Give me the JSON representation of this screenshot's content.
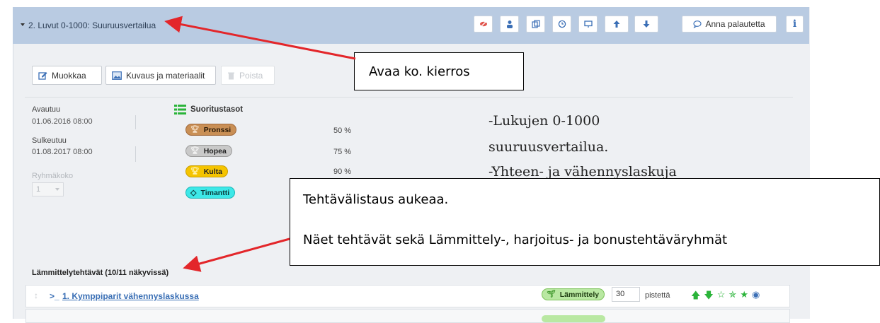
{
  "header": {
    "title": "2. Luvut 0-1000: Suuruusvertailua",
    "feedback_label": "Anna palautetta",
    "info_label": "i"
  },
  "toolbar": {
    "edit_label": "Muokkaa",
    "description_label": "Kuvaus ja materiaalit",
    "delete_label": "Poista"
  },
  "schedule": {
    "opens_label": "Avautuu",
    "opens_value": "01.06.2016 08:00",
    "closes_label": "Sulkeutuu",
    "closes_value": "01.08.2017 08:00",
    "group_label": "Ryhmäkoko",
    "group_value": "1"
  },
  "levels": {
    "heading": "Suoritustasot",
    "items": [
      {
        "name": "Pronssi",
        "percent": "50 %"
      },
      {
        "name": "Hopea",
        "percent": "75 %"
      },
      {
        "name": "Kulta",
        "percent": "90 %"
      },
      {
        "name": "Timantti",
        "percent": ""
      }
    ]
  },
  "description": {
    "line1": "-Lukujen 0-1000",
    "line2": "suuruusvertailua.",
    "line3": "-Yhteen- ja vähennyslaskuja"
  },
  "callouts": {
    "open_round": "Avaa ko. kierros",
    "list_line1": "Tehtävälistaus aukeaa.",
    "list_line2": "Näet tehtävät sekä Lämmittely-, harjoitus- ja bonustehtäväryhmät"
  },
  "tasks": {
    "group_heading": "Lämmittelytehtävät (10/11 näkyvissä)",
    "rows": [
      {
        "prefix": ">_",
        "title": "1. Kymppiparit vähennyslaskussa",
        "type": "Lämmittely",
        "points": "30",
        "points_label": "pistettä"
      }
    ]
  },
  "colors": {
    "header_bg": "#b9cbe2",
    "bronze": "#c98f55",
    "silver": "#bfbfbf",
    "gold": "#f5c400",
    "diamond": "#3de8e8",
    "warmup": "#b9e8a2",
    "arrow": "#e3262a",
    "accent_blue": "#3b6fb6"
  }
}
